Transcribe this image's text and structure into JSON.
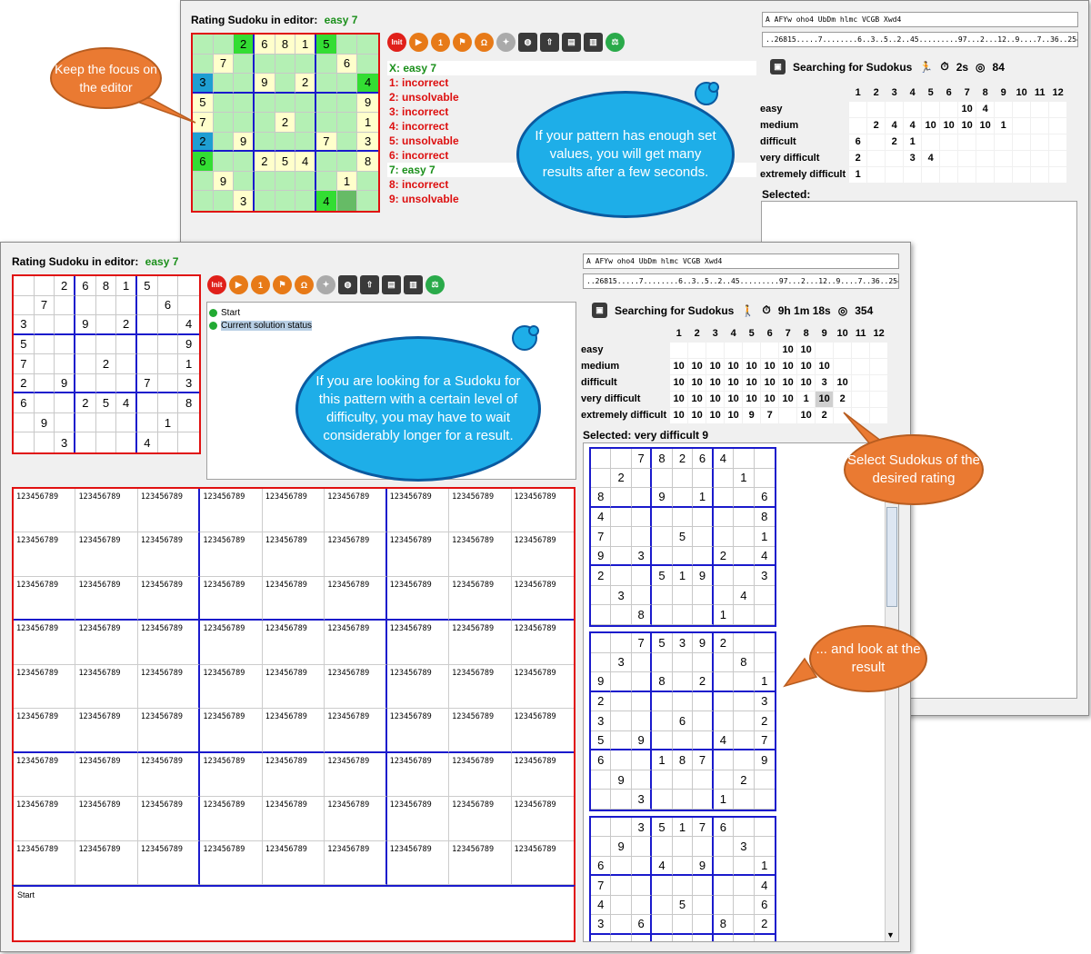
{
  "back": {
    "rating_label": "Rating Sudoku in editor:",
    "rating_value": "easy 7",
    "field1": "A AFYw oho4 UbDm hlmc VCGB Xwd4",
    "field2": "..26815.....7........6..3..5..2..45.........97...2...12..9....7..36..254...8..9.....",
    "grid": [
      [
        "",
        "",
        "2",
        "6",
        "8",
        "1",
        "5",
        "",
        ""
      ],
      [
        "",
        "7",
        "",
        "",
        "",
        "",
        "",
        "6",
        ""
      ],
      [
        "3",
        "",
        "",
        "9",
        "",
        "2",
        "",
        "",
        "4"
      ],
      [
        "5",
        "",
        "",
        "",
        "",
        "",
        "",
        "",
        "9"
      ],
      [
        "7",
        "",
        "",
        "",
        "2",
        "",
        "",
        "",
        "1"
      ],
      [
        "2",
        "",
        "9",
        "",
        "",
        "",
        "7",
        "",
        "3"
      ],
      [
        "6",
        "",
        "",
        "2",
        "5",
        "4",
        "",
        "",
        "8"
      ],
      [
        "",
        "9",
        "",
        "",
        "",
        "",
        "",
        "1",
        ""
      ],
      [
        "",
        "",
        "3",
        "",
        "",
        "",
        "4",
        "",
        ""
      ]
    ],
    "cell_colors": [
      [
        "g",
        "g",
        "G",
        "y",
        "y",
        "y",
        "G",
        "g",
        "g"
      ],
      [
        "g",
        "y",
        "g",
        "g",
        "g",
        "g",
        "g",
        "y",
        "g"
      ],
      [
        "b",
        "g",
        "g",
        "y",
        "g",
        "y",
        "g",
        "g",
        "G"
      ],
      [
        "y",
        "g",
        "g",
        "g",
        "g",
        "g",
        "g",
        "g",
        "y"
      ],
      [
        "y",
        "g",
        "g",
        "g",
        "y",
        "g",
        "g",
        "g",
        "y"
      ],
      [
        "b",
        "g",
        "y",
        "g",
        "g",
        "g",
        "y",
        "g",
        "y"
      ],
      [
        "G",
        "g",
        "g",
        "y",
        "y",
        "y",
        "g",
        "g",
        "y"
      ],
      [
        "g",
        "y",
        "g",
        "g",
        "g",
        "g",
        "g",
        "y",
        "g"
      ],
      [
        "g",
        "g",
        "y",
        "g",
        "g",
        "g",
        "G",
        "d",
        "g"
      ]
    ],
    "results": [
      {
        "text": "X: easy 7",
        "ok": true,
        "sel": true
      },
      {
        "text": "1: incorrect",
        "ok": false
      },
      {
        "text": "2: unsolvable",
        "ok": false
      },
      {
        "text": "3: incorrect",
        "ok": false
      },
      {
        "text": "4: incorrect",
        "ok": false
      },
      {
        "text": "5: unsolvable",
        "ok": false
      },
      {
        "text": "6: incorrect",
        "ok": false
      },
      {
        "text": "7: easy 7",
        "ok": true,
        "sel": true
      },
      {
        "text": "8: incorrect",
        "ok": false
      },
      {
        "text": "9: unsolvable",
        "ok": false
      }
    ],
    "search_label": "Searching for Sudokus",
    "search_time": "2s",
    "search_count": "84",
    "table_rows": [
      {
        "name": "easy",
        "vals": [
          "",
          "",
          "",
          "",
          "",
          "",
          "10",
          "4",
          "",
          "",
          "",
          ""
        ]
      },
      {
        "name": "medium",
        "vals": [
          "",
          "2",
          "4",
          "4",
          "10",
          "10",
          "10",
          "10",
          "1",
          "",
          "",
          ""
        ]
      },
      {
        "name": "difficult",
        "vals": [
          "6",
          "",
          "2",
          "1",
          "",
          "",
          "",
          "",
          "",
          "",
          "",
          ""
        ]
      },
      {
        "name": "very difficult",
        "vals": [
          "2",
          "",
          "",
          "3",
          "4",
          "",
          "",
          "",
          "",
          "",
          "",
          ""
        ]
      },
      {
        "name": "extremely difficult",
        "vals": [
          "1",
          "",
          "",
          "",
          "",
          "",
          "",
          "",
          "",
          "",
          "",
          ""
        ]
      }
    ],
    "selected_label": "Selected:"
  },
  "front": {
    "rating_label": "Rating Sudoku in editor:",
    "rating_value": "easy 7",
    "field1": "A AFYw oho4 UbDm hlmc VCGB Xwd4",
    "field2": "..26815.....7........6..3..5..2..45.........97...2...12..9....7..36..254...8..9.....",
    "grid": [
      [
        "",
        "",
        "2",
        "6",
        "8",
        "1",
        "5",
        "",
        ""
      ],
      [
        "",
        "7",
        "",
        "",
        "",
        "",
        "",
        "6",
        ""
      ],
      [
        "3",
        "",
        "",
        "9",
        "",
        "2",
        "",
        "",
        "4"
      ],
      [
        "5",
        "",
        "",
        "",
        "",
        "",
        "",
        "",
        "9"
      ],
      [
        "7",
        "",
        "",
        "",
        "2",
        "",
        "",
        "",
        "1"
      ],
      [
        "2",
        "",
        "9",
        "",
        "",
        "",
        "7",
        "",
        "3"
      ],
      [
        "6",
        "",
        "",
        "2",
        "5",
        "4",
        "",
        "",
        "8"
      ],
      [
        "",
        "9",
        "",
        "",
        "",
        "",
        "",
        "1",
        ""
      ],
      [
        "",
        "",
        "3",
        "",
        "",
        "",
        "4",
        "",
        ""
      ]
    ],
    "tree": [
      "Start",
      "Current solution status"
    ],
    "search_label": "Searching for Sudokus",
    "search_time": "9h 1m 18s",
    "search_count": "354",
    "table_rows": [
      {
        "name": "easy",
        "vals": [
          "",
          "",
          "",
          "",
          "",
          "",
          "10",
          "10",
          "",
          "",
          "",
          ""
        ]
      },
      {
        "name": "medium",
        "vals": [
          "10",
          "10",
          "10",
          "10",
          "10",
          "10",
          "10",
          "10",
          "10",
          "",
          "",
          ""
        ]
      },
      {
        "name": "difficult",
        "vals": [
          "10",
          "10",
          "10",
          "10",
          "10",
          "10",
          "10",
          "10",
          "3",
          "10",
          "",
          ""
        ]
      },
      {
        "name": "very difficult",
        "vals": [
          "10",
          "10",
          "10",
          "10",
          "10",
          "10",
          "10",
          "1",
          "10",
          "2",
          "",
          ""
        ]
      },
      {
        "name": "extremely difficult",
        "vals": [
          "10",
          "10",
          "10",
          "10",
          "9",
          "7",
          "",
          "10",
          "2",
          "",
          "",
          ""
        ]
      }
    ],
    "selected_label": "Selected: very difficult 9",
    "candidates": "123456789",
    "status_text": "Start",
    "results": [
      [
        [
          "",
          "",
          "7",
          "8",
          "2",
          "6",
          "4",
          "",
          ""
        ],
        [
          "",
          "2",
          "",
          "",
          "",
          "",
          "",
          "1",
          ""
        ],
        [
          "8",
          "",
          "",
          "9",
          "",
          "1",
          "",
          "",
          "6"
        ],
        [
          "4",
          "",
          "",
          "",
          "",
          "",
          "",
          "",
          "8"
        ],
        [
          "7",
          "",
          "",
          "",
          "5",
          "",
          "",
          "",
          "1"
        ],
        [
          "9",
          "",
          "3",
          "",
          "",
          "",
          "2",
          "",
          "4"
        ],
        [
          "2",
          "",
          "",
          "5",
          "1",
          "9",
          "",
          "",
          "3"
        ],
        [
          "",
          "3",
          "",
          "",
          "",
          "",
          "",
          "4",
          ""
        ],
        [
          "",
          "",
          "8",
          "",
          "",
          "",
          "1",
          "",
          ""
        ]
      ],
      [
        [
          "",
          "",
          "7",
          "5",
          "3",
          "9",
          "2",
          "",
          ""
        ],
        [
          "",
          "3",
          "",
          "",
          "",
          "",
          "",
          "8",
          ""
        ],
        [
          "9",
          "",
          "",
          "8",
          "",
          "2",
          "",
          "",
          "1"
        ],
        [
          "2",
          "",
          "",
          "",
          "",
          "",
          "",
          "",
          "3"
        ],
        [
          "3",
          "",
          "",
          "",
          "6",
          "",
          "",
          "",
          "2"
        ],
        [
          "5",
          "",
          "9",
          "",
          "",
          "",
          "4",
          "",
          "7"
        ],
        [
          "6",
          "",
          "",
          "1",
          "8",
          "7",
          "",
          "",
          "9"
        ],
        [
          "",
          "9",
          "",
          "",
          "",
          "",
          "",
          "2",
          ""
        ],
        [
          "",
          "",
          "3",
          "",
          "",
          "",
          "1",
          "",
          ""
        ]
      ],
      [
        [
          "",
          "",
          "3",
          "5",
          "1",
          "7",
          "6",
          "",
          ""
        ],
        [
          "",
          "9",
          "",
          "",
          "",
          "",
          "",
          "3",
          ""
        ],
        [
          "6",
          "",
          "",
          "4",
          "",
          "9",
          "",
          "",
          "1"
        ],
        [
          "7",
          "",
          "",
          "",
          "",
          "",
          "",
          "",
          "4"
        ],
        [
          "4",
          "",
          "",
          "",
          "5",
          "",
          "",
          "",
          "6"
        ],
        [
          "3",
          "",
          "6",
          "",
          "",
          "",
          "8",
          "",
          "2"
        ],
        [
          "",
          "",
          "",
          "",
          "",
          "",
          "",
          "",
          ""
        ]
      ]
    ]
  },
  "table_header": [
    "1",
    "2",
    "3",
    "4",
    "5",
    "6",
    "7",
    "8",
    "9",
    "10",
    "11",
    "12"
  ],
  "callouts": {
    "focus": "Keep the focus on the editor",
    "pattern": "If your pattern has enough set values, you will get many results after a few seconds.",
    "looking": "If you are looking for a Sudoku for this pattern with a certain level of difficulty, you may have to wait considerably longer for a result.",
    "select": "Select Sudokus of the desired rating",
    "look": "... and look at the result"
  },
  "toolbar_icons": [
    "init-icon",
    "play-icon",
    "one-icon",
    "walk-icon",
    "omega-icon",
    "wand-icon",
    "globe-icon",
    "export-icon",
    "save-icon",
    "print-icon",
    "balance-icon"
  ],
  "toolbar_init_label": "Init",
  "toolbar_one_label": "1",
  "toolbar_omega_label": "Ω",
  "colors": {
    "red_border": "#e01010",
    "blue_border": "#1a1acc",
    "green_text": "#1a8f1a",
    "error_text": "#dd1010",
    "cloud": "#1eaee8",
    "callout": "#ea7a32"
  }
}
